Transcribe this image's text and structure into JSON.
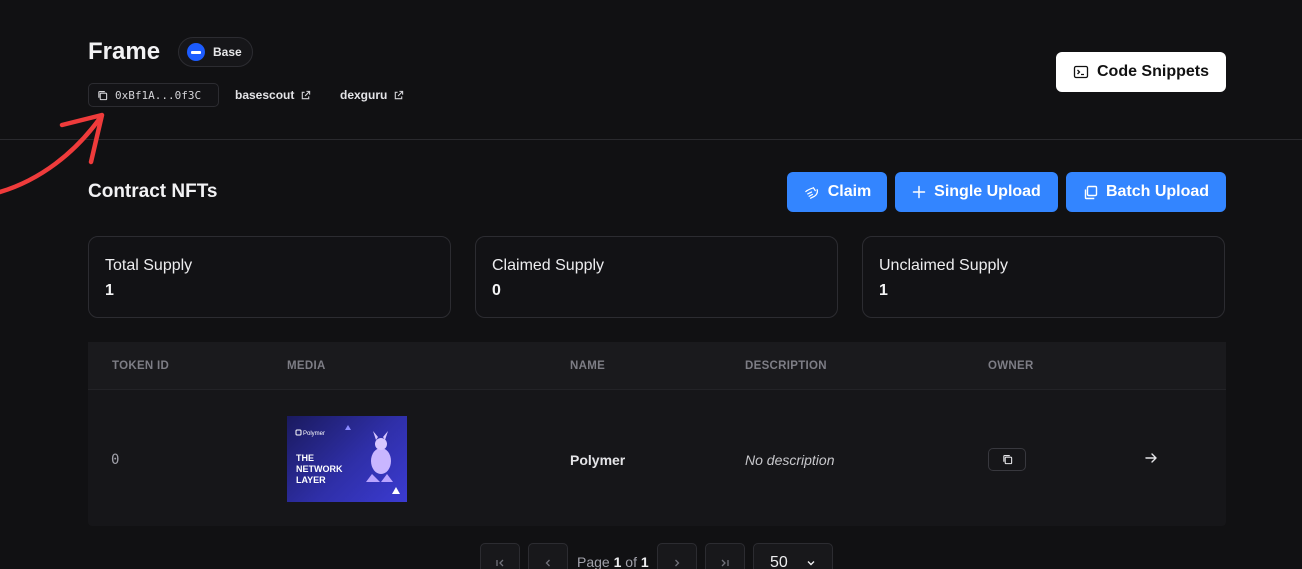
{
  "header": {
    "title": "Frame",
    "chain": "Base",
    "address": "0xBf1A...0f3C",
    "links": [
      "basescout",
      "dexguru"
    ],
    "code_snippets_label": "Code Snippets"
  },
  "section": {
    "title": "Contract NFTs",
    "claim_label": "Claim",
    "single_upload_label": "Single Upload",
    "batch_upload_label": "Batch Upload"
  },
  "stats": [
    {
      "label": "Total Supply",
      "value": "1"
    },
    {
      "label": "Claimed Supply",
      "value": "0"
    },
    {
      "label": "Unclaimed Supply",
      "value": "1"
    }
  ],
  "table": {
    "columns": [
      "TOKEN ID",
      "MEDIA",
      "NAME",
      "DESCRIPTION",
      "OWNER"
    ],
    "rows": [
      {
        "token_id": "0",
        "media": {
          "brand": "Polymer",
          "headline": [
            "THE",
            "NETWORK",
            "LAYER"
          ]
        },
        "name": "Polymer",
        "description": "No description"
      }
    ]
  },
  "pagination": {
    "page_word": "Page",
    "current": "1",
    "of_word": "of",
    "total": "1",
    "per_page": "50"
  },
  "colors": {
    "background": "#111113",
    "accent": "#3385ff",
    "annotation": "#ef3b3b"
  }
}
